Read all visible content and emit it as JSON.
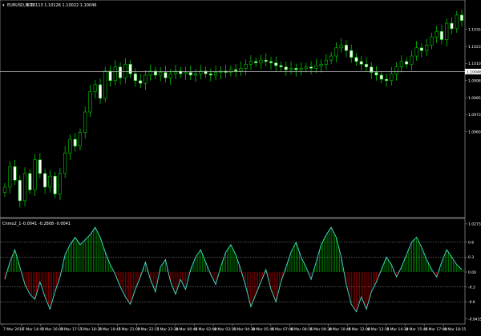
{
  "main_header": {
    "symbol": "EURUSD,M15",
    "ohlc": "1.10113 1.10126 1.10022 1.10046"
  },
  "indicator_header": {
    "name": "Chmo2_1",
    "values": "-0.0041 -0.2808 -0.0041"
  },
  "current_price": "1.10046",
  "price_axis": {
    "range": [
      1.09,
      1.105
    ],
    "ticks": [
      "1.10355",
      "1.10230",
      "1.10105",
      "1.09980",
      "1.09855",
      "1.09730",
      "1.09605"
    ]
  },
  "indicator_axis": {
    "range": [
      -1.0,
      1.0
    ],
    "ticks": [
      "1.0273",
      "0.6",
      "0.3",
      "0.00",
      "-0.3",
      "-0.6",
      "-0.9435"
    ],
    "levels": [
      0.6,
      0.3,
      -0.3,
      -0.6
    ]
  },
  "time_axis": [
    "7 Mar 2016",
    "7 Mar 14:45",
    "7 Mar 16:00",
    "7 Mar 17:15",
    "7 Mar 18:30",
    "7 Mar 19:45",
    "7 Mar 21:00",
    "7 Mar 22:15",
    "7 Mar 23:30",
    "8 Mar 00:45",
    "8 Mar 02:00",
    "8 Mar 03:15",
    "8 Mar 04:30",
    "8 Mar 05:45",
    "8 Mar 07:00",
    "8 Mar 08:15",
    "8 Mar 09:30",
    "8 Mar 10:45",
    "8 Mar 12:00",
    "8 Mar 13:15",
    "8 Mar 14:30",
    "8 Mar 15:45",
    "8 Mar 17:00",
    "8 Mar 18:15"
  ],
  "chart_data": [
    {
      "type": "candlestick",
      "title": "EURUSD,M15",
      "ylim": [
        1.09,
        1.105
      ],
      "close": [
        1.092,
        1.0935,
        1.0925,
        1.091,
        1.093,
        1.0918,
        1.094,
        1.093,
        1.092,
        1.0928,
        1.0915,
        1.093,
        1.0945,
        1.0955,
        1.095,
        1.096,
        1.0975,
        1.099,
        1.0995,
        1.0985,
        1.1005,
        1.0998,
        1.1008,
        1.1,
        1.101,
        1.1003,
        1.0998,
        1.0996,
        1.1002,
        1.1005,
        1.1002,
        1.1004,
        1.1,
        1.1003,
        1.1005,
        1.1003,
        1.1004,
        1.1002,
        1.1003,
        1.1005,
        1.1003,
        1.1002,
        1.1004,
        1.1005,
        1.1004,
        1.1006,
        1.1005,
        1.1007,
        1.101,
        1.1012,
        1.1011,
        1.1013,
        1.1012,
        1.1011,
        1.1009,
        1.1008,
        1.1006,
        1.1007,
        1.1006,
        1.1007,
        1.1008,
        1.1007,
        1.1009,
        1.101,
        1.1013,
        1.1016,
        1.1022,
        1.1024,
        1.102,
        1.1015,
        1.1012,
        1.101,
        1.1008,
        1.1004,
        1.1002,
        1.0999,
        1.0998,
        1.1003,
        1.1008,
        1.1012,
        1.101,
        1.1016,
        1.1022,
        1.102,
        1.1024,
        1.103,
        1.1034,
        1.1028,
        1.104,
        1.1036,
        1.1046,
        1.1042
      ]
    },
    {
      "type": "line",
      "title": "Chmo2_1",
      "ylim": [
        -1.0,
        1.0
      ],
      "values": [
        -0.15,
        0.2,
        0.45,
        0.1,
        -0.25,
        -0.45,
        -0.55,
        -0.2,
        -0.5,
        -0.75,
        -0.4,
        -0.1,
        0.35,
        0.55,
        0.7,
        0.55,
        0.65,
        0.75,
        0.9,
        0.7,
        0.4,
        0.15,
        -0.05,
        -0.3,
        -0.5,
        -0.65,
        -0.35,
        -0.1,
        0.2,
        -0.15,
        -0.4,
        0.1,
        0.25,
        -0.2,
        -0.45,
        -0.15,
        -0.35,
        0.05,
        0.3,
        0.45,
        0.2,
        -0.05,
        -0.25,
        0.1,
        0.4,
        0.55,
        0.35,
        0.05,
        -0.3,
        -0.7,
        -0.45,
        -0.2,
        0.05,
        -0.35,
        -0.6,
        -0.2,
        0.1,
        0.4,
        0.6,
        0.3,
        0.1,
        -0.15,
        0.2,
        0.55,
        0.75,
        0.9,
        0.7,
        0.3,
        -0.25,
        -0.65,
        -0.8,
        -0.5,
        -0.75,
        -0.4,
        -0.2,
        0.05,
        0.3,
        0.15,
        -0.1,
        0.1,
        0.35,
        0.6,
        0.7,
        0.5,
        0.25,
        0.05,
        -0.1,
        0.2,
        0.45,
        0.3,
        0.15,
        0.05
      ]
    }
  ]
}
